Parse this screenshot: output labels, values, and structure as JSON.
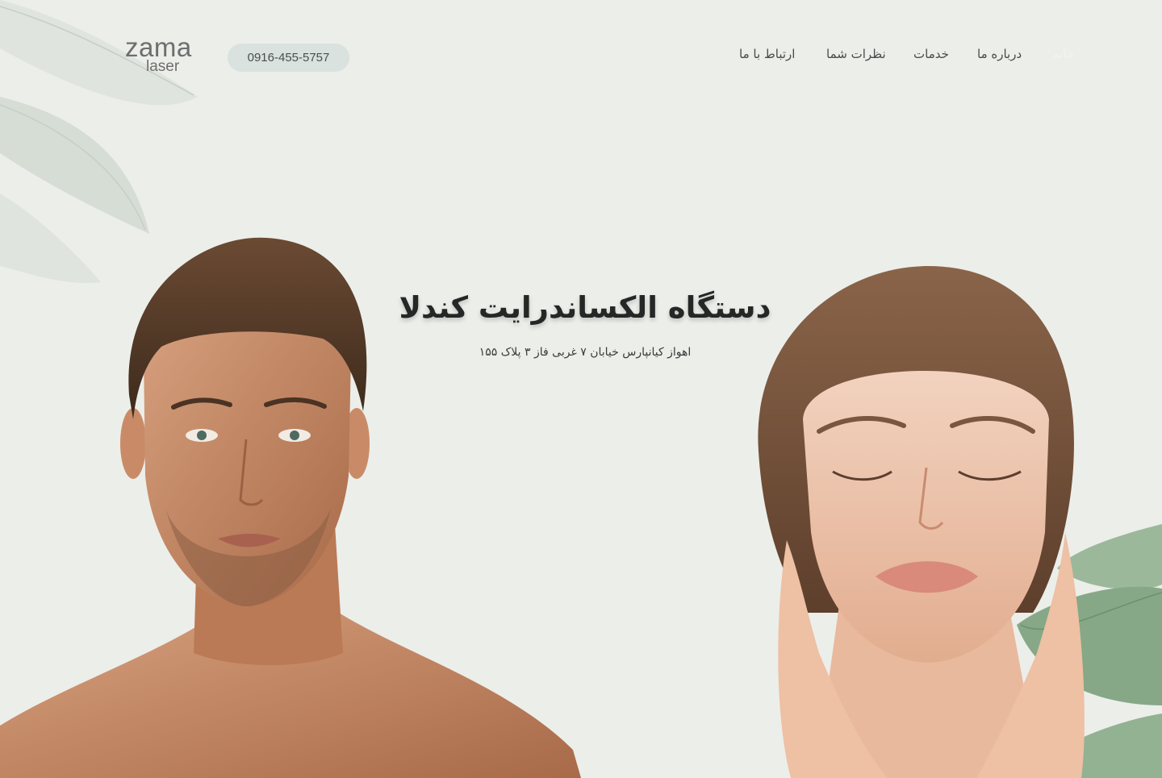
{
  "logo": {
    "main": "zama",
    "sub": "laser"
  },
  "phone": "0916-455-5757",
  "nav": [
    {
      "label": "خانه",
      "active": true
    },
    {
      "label": "درباره ما",
      "active": false
    },
    {
      "label": "خدمات",
      "active": false
    },
    {
      "label": "نظرات شما",
      "active": false
    },
    {
      "label": "ارتباط با ما",
      "active": false
    }
  ],
  "hero": {
    "title": "دستگاه الکساندرایت کندلا",
    "address": "اهواز کیانپارس خیابان ۷ غربی فاز ۳ پلاک ۱۵۵"
  },
  "colors": {
    "background": "#eceeea",
    "pill": "#d9e2de",
    "leaf_light": "#d3dad3",
    "leaf_green": "#8faf8f"
  }
}
